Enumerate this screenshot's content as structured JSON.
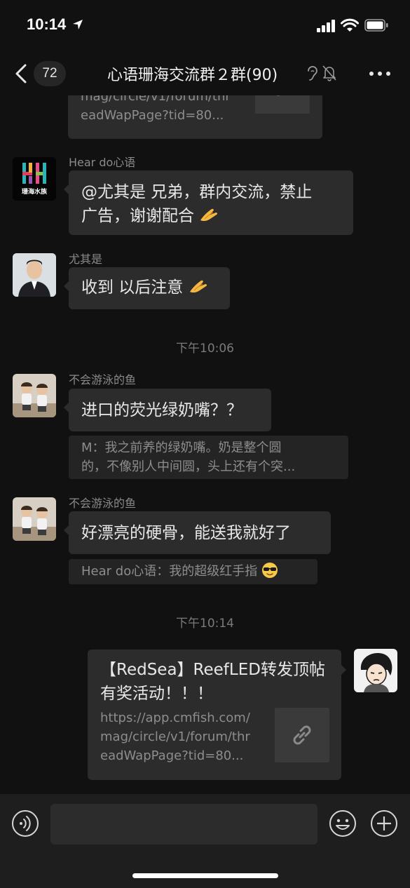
{
  "status_bar": {
    "time": "10:14"
  },
  "nav": {
    "back_count": "72",
    "title": "心语珊海交流群２群(90)"
  },
  "top_card": {
    "url_lines": [
      "mag/circle/v1/forum/thr",
      "eadWapPage?tid=80..."
    ]
  },
  "messages": [
    {
      "sender": "Hear do心语",
      "avatar": "shanhai-logo",
      "avatar_text": "珊海水族",
      "text_line1": "@尤其是 兄弟，群内交流，禁止",
      "text_line2": "广告，谢谢配合"
    },
    {
      "sender": "尤其是",
      "avatar": "man-portrait",
      "text": "收到 以后注意"
    }
  ],
  "timestamp_1": "下午10:06",
  "messages_2": [
    {
      "sender": "不会游泳的鱼",
      "avatar": "two-kids-photo",
      "text": "进口的荧光绿奶嘴？？",
      "quote_line1": "M：我之前养的绿奶嘴。奶是整个圆",
      "quote_line2": "的，不像别人中间圆，头上还有个突..."
    },
    {
      "sender": "不会游泳的鱼",
      "avatar": "two-kids-photo",
      "text": "好漂亮的硬骨，能送我就好了",
      "quote": "Hear do心语：我的超级红手指"
    }
  ],
  "timestamp_2": "下午10:14",
  "link_message": {
    "title": "【RedSea】ReefLED转发顶帖有奖活动！！！",
    "url_lines": [
      "https://app.cmfish.com/",
      "mag/circle/v1/forum/thr",
      "eadWapPage?tid=80..."
    ],
    "avatar": "cartoon-avatar"
  },
  "colors": {
    "background": "#111111",
    "bubble": "#2c2c2c",
    "input_bar": "#1e1e1e"
  }
}
